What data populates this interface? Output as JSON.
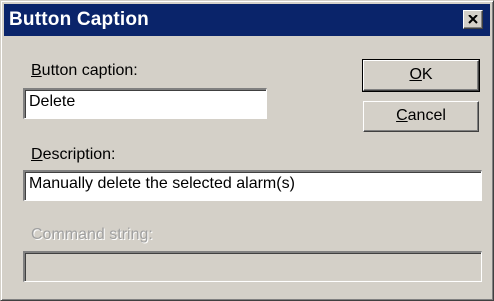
{
  "window": {
    "title": "Button Caption",
    "close_icon": "close-x-icon"
  },
  "form": {
    "button_caption": {
      "label_accel": "B",
      "label_rest": "utton caption:",
      "value": "Delete"
    },
    "description": {
      "label_accel": "D",
      "label_rest": "escription:",
      "value": "Manually delete the selected alarm(s)"
    },
    "command_string": {
      "label": "Command string:",
      "value": "",
      "enabled": false
    }
  },
  "buttons": {
    "ok": {
      "accel": "O",
      "rest": "K"
    },
    "cancel": {
      "accel": "C",
      "rest": "ancel"
    }
  }
}
